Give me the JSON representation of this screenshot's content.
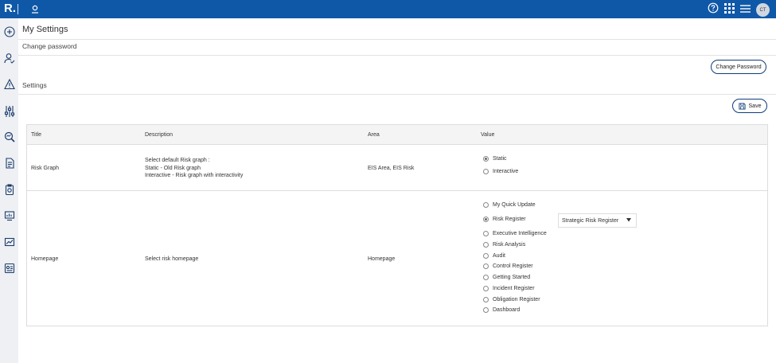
{
  "app": {
    "logo": "R."
  },
  "topbar": {
    "icons": [
      "user-icon",
      "help-icon",
      "apps-grid-icon",
      "menu-icon"
    ],
    "avatar_initials": "CT"
  },
  "sidebar": {
    "icons": [
      "add-icon",
      "user-check-icon",
      "warning-icon",
      "sliders-icon",
      "search-analyze-icon",
      "document-icon",
      "clipboard-icon",
      "monitor-report-icon",
      "chart-icon",
      "id-card-icon"
    ]
  },
  "page": {
    "title": "My Settings",
    "change_password_section": "Change password",
    "change_password_button": "Change Password",
    "settings_section": "Settings",
    "save_button": "Save"
  },
  "table": {
    "headers": [
      "Title",
      "Description",
      "Area",
      "Value"
    ],
    "rows": [
      {
        "title": "Risk Graph",
        "description": [
          "Select default Risk graph :",
          "Static - Old Risk graph",
          "Interactive - Risk graph with interactivity"
        ],
        "area": "EIS Area, EIS Risk",
        "options": [
          {
            "label": "Static",
            "selected": true
          },
          {
            "label": "Interactive",
            "selected": false
          }
        ]
      },
      {
        "title": "Homepage",
        "description": [
          "Select risk homepage"
        ],
        "area": "Homepage",
        "options": [
          {
            "label": "My Quick Update",
            "selected": false
          },
          {
            "label": "Risk Register",
            "selected": true
          },
          {
            "label": "Executive Intelligence",
            "selected": false
          },
          {
            "label": "Risk Analysis",
            "selected": false
          },
          {
            "label": "Audit",
            "selected": false
          },
          {
            "label": "Control Register",
            "selected": false
          },
          {
            "label": "Getting Started",
            "selected": false
          },
          {
            "label": "Incident Register",
            "selected": false
          },
          {
            "label": "Obligation Register",
            "selected": false
          },
          {
            "label": "Dashboard",
            "selected": false
          }
        ],
        "register_select": "Strategic Risk Register"
      }
    ]
  },
  "colors": {
    "brand": "#0f58a8",
    "button_border": "#0f3d7a"
  }
}
